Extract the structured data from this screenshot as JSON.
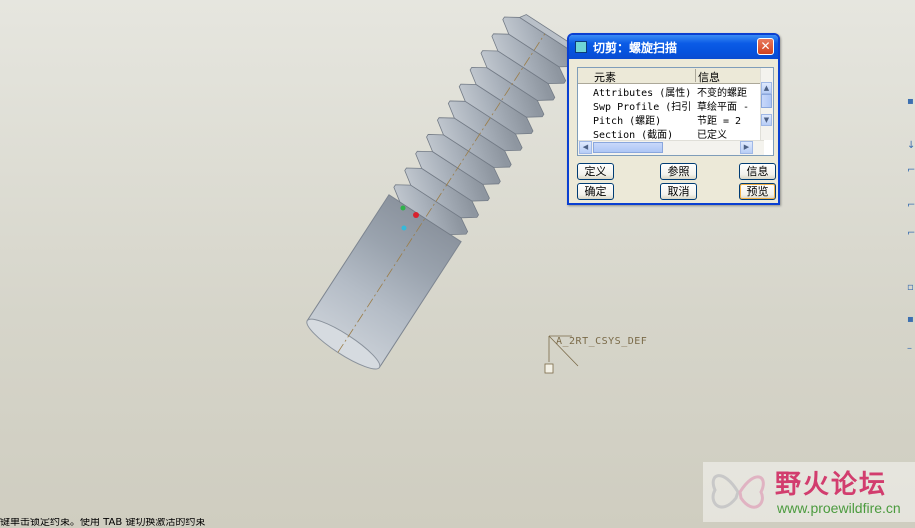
{
  "viewport": {
    "csys_label": "A_2RT_CSYS_DEF"
  },
  "dialog": {
    "title": "切剪：螺旋扫描",
    "close_glyph": "✕",
    "columns": [
      "元素",
      "信息"
    ],
    "rows": [
      {
        "element": "Attributes (属性)",
        "info": "不变的螺距"
      },
      {
        "element": "Swp Profile (扫引",
        "info": "草绘平面 -"
      },
      {
        "element": "Pitch (螺距)",
        "info": "节距 = 2"
      },
      {
        "element": "Section (截面)",
        "info": "已定义"
      }
    ],
    "buttons": {
      "define": "定义",
      "reference": "参照",
      "info": "信息",
      "ok": "确定",
      "cancel": "取消",
      "preview": "预览"
    }
  },
  "status_bar": {
    "message": "键单击锁定约束。使用 TAB 键切换激活的约束"
  },
  "watermark": {
    "brand": "野火论坛",
    "url": "www.proewildfire.cn"
  },
  "colors": {
    "title_bar": "#0653de",
    "model_gray": "#a9b0b8",
    "background": "#dcdbd1",
    "watermark_brand": "#d23d6e",
    "watermark_url": "#4b9b3e"
  }
}
